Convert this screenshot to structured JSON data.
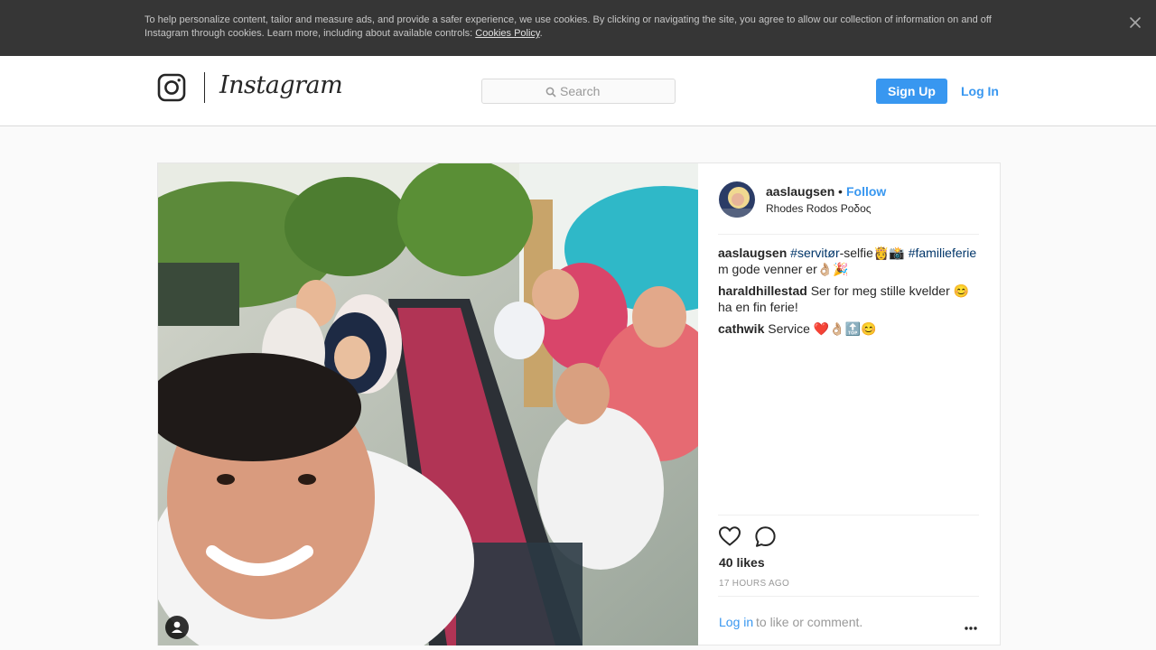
{
  "cookie_banner": {
    "text": "To help personalize content, tailor and measure ads, and provide a safer experience, we use cookies. By clicking or navigating the site, you agree to allow our collection of information on and off Instagram through cookies. Learn more, including about available controls: ",
    "link_label": "Cookies Policy",
    "trailing": ".",
    "close_icon": "close-icon"
  },
  "header": {
    "wordmark": "Instagram",
    "logo_icon": "instagram-camera-icon",
    "search_placeholder": "Search",
    "search_icon": "search-icon",
    "signup_label": "Sign Up",
    "login_label": "Log In"
  },
  "post": {
    "username": "aaslaugsen",
    "separator": "•",
    "follow_label": "Follow",
    "location": "Rhodes Rodos Ροδος",
    "caption": {
      "user": "aaslaugsen",
      "hashtag1": "#servitør",
      "mid_text": "-selfie👸📸",
      "hashtag2": "#familieferie",
      "line2": "m gode venner er👌🏼🎉"
    },
    "comments": [
      {
        "user": "haraldhillestad",
        "text": "Ser for meg stille kvelder 😊 ha en fin ferie!"
      },
      {
        "user": "cathwik",
        "text": "Service ❤️👌🏼🔝😊"
      }
    ],
    "likes": "40 likes",
    "time_ago": "17 HOURS AGO",
    "login_inline": "Log in",
    "to_like_text": "to like or comment.",
    "icons": [
      "heart-icon",
      "comment-icon",
      "more-options-icon",
      "user-tag-icon"
    ]
  },
  "colors": {
    "accent": "#3897f0",
    "banner_bg": "#363636",
    "hashtag": "#003569",
    "muted": "#999999"
  }
}
